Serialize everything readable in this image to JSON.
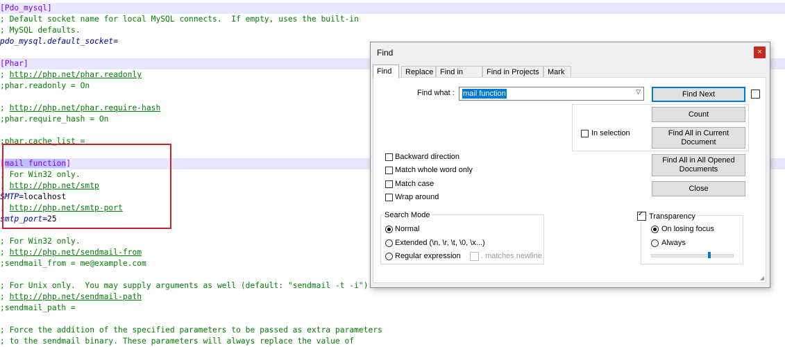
{
  "editor": {
    "l0_section": "[Pdo_mysql]",
    "l1": "; Default socket name for local MySQL connects.  If empty, uses the built-in",
    "l2": "; MySQL defaults.",
    "l3_key": "pdo_mysql.default_socket",
    "l3_eq": "=",
    "l5_section": "[Phar]",
    "l6_pre": "; ",
    "l6_link": "http://php.net/phar.readonly",
    "l7": ";phar.readonly = On",
    "l9_pre": "; ",
    "l9_link": "http://php.net/phar.require-hash",
    "l10": ";phar.require_hash = On",
    "l12": ";phar.cache_list =",
    "l14_open": "[",
    "l14_sel": "mail function",
    "l14_close": "]",
    "l15": "; For Win32 only.",
    "l16_pre": "; ",
    "l16_link": "http://php.net/smtp",
    "l17_key": "SMTP",
    "l17_eq": "=",
    "l17_val": "localhost",
    "l18_pre": "; ",
    "l18_link": "http://php.net/smtp-port",
    "l19_key": "smtp_port",
    "l19_eq": "=",
    "l19_val": "25",
    "l21": "; For Win32 only.",
    "l22_pre": "; ",
    "l22_link": "http://php.net/sendmail-from",
    "l23": ";sendmail_from = me@example.com",
    "l25": "; For Unix only.  You may supply arguments as well (default: \"sendmail -t -i\").",
    "l26_pre": "; ",
    "l26_link": "http://php.net/sendmail-path",
    "l27": ";sendmail_path =",
    "l29": "; Force the addition of the specified parameters to be passed as extra parameters",
    "l30": "; to the sendmail binary. These parameters will always replace the value of"
  },
  "dialog": {
    "title": "Find",
    "close_glyph": "×",
    "tabs": [
      "Find",
      "Replace",
      "Find in Files",
      "Find in Projects",
      "Mark"
    ],
    "find_what_label": "Find what :",
    "find_what_value": "mail function",
    "dropdown_glyph": "▽",
    "buttons": {
      "find_next": "Find Next",
      "count": "Count",
      "find_all_current": "Find All in Current Document",
      "find_all_opened": "Find All in All Opened Documents",
      "close": "Close"
    },
    "in_selection": "In selection",
    "options": {
      "backward": "Backward direction",
      "whole_word": "Match whole word only",
      "match_case": "Match case",
      "wrap_around": "Wrap around"
    },
    "search_mode": {
      "title": "Search Mode",
      "normal": "Normal",
      "extended": "Extended (\\n, \\r, \\t, \\0, \\x...)",
      "regex": "Regular expression",
      "matches_newline": ". matches newline"
    },
    "transparency": {
      "title": "Transparency",
      "on_losing_focus": "On losing focus",
      "always": "Always",
      "slider_value": 0.72
    }
  },
  "colors": {
    "red_box": "#d0202a",
    "accent": "#0078d7",
    "section": "#8000ff",
    "comment": "#008000",
    "current_line": "#e8e8ff"
  }
}
